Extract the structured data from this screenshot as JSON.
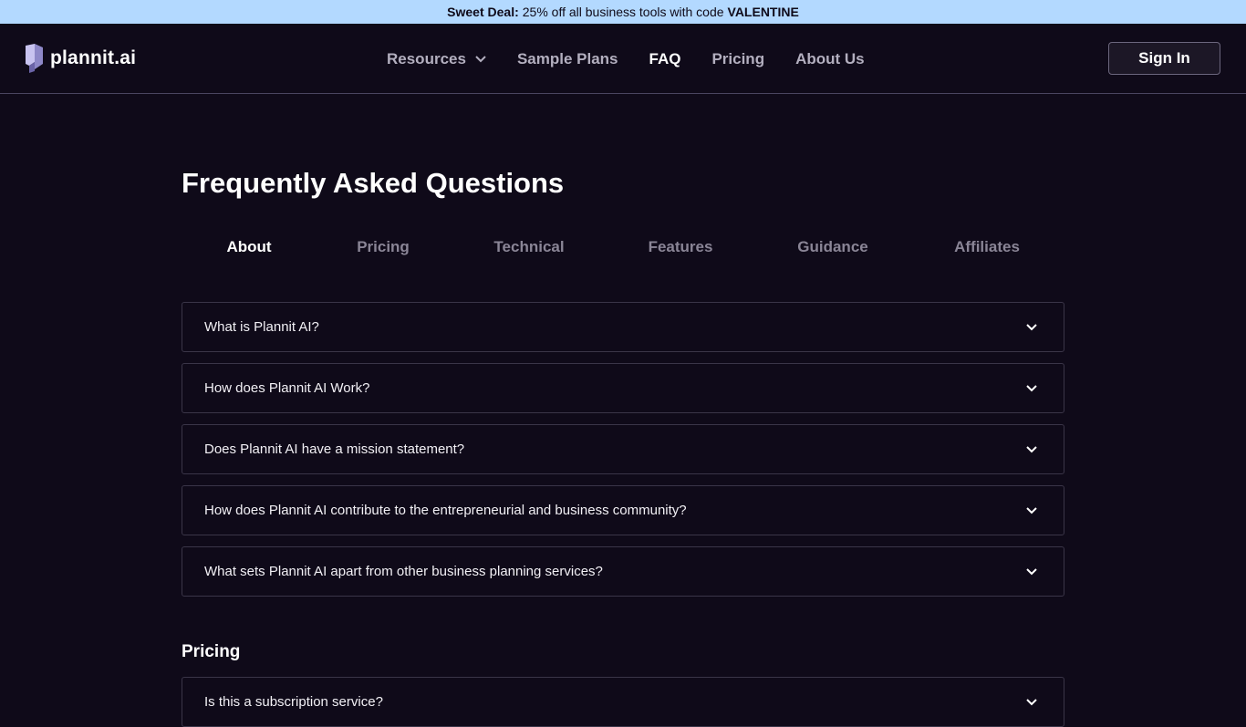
{
  "promo": {
    "lead": "Sweet Deal:",
    "text": "25% off all business tools with code",
    "code": "VALENTINE"
  },
  "brand": {
    "name": "plannit.ai",
    "accent": "#b3d9ff",
    "logo_color": "#c8c3f0"
  },
  "nav": {
    "resources": "Resources",
    "sample_plans": "Sample Plans",
    "faq": "FAQ",
    "pricing": "Pricing",
    "about": "About Us",
    "signin": "Sign In"
  },
  "page": {
    "title": "Frequently Asked Questions"
  },
  "tabs": [
    "About",
    "Pricing",
    "Technical",
    "Features",
    "Guidance",
    "Affiliates"
  ],
  "about_faqs": [
    "What is Plannit AI?",
    "How does Plannit AI Work?",
    "Does Plannit AI have a mission statement?",
    "How does Plannit AI contribute to the entrepreneurial and business community?",
    "What sets Plannit AI apart from other business planning services?"
  ],
  "pricing_section": {
    "title": "Pricing",
    "first_question": "Is this a subscription service?"
  }
}
